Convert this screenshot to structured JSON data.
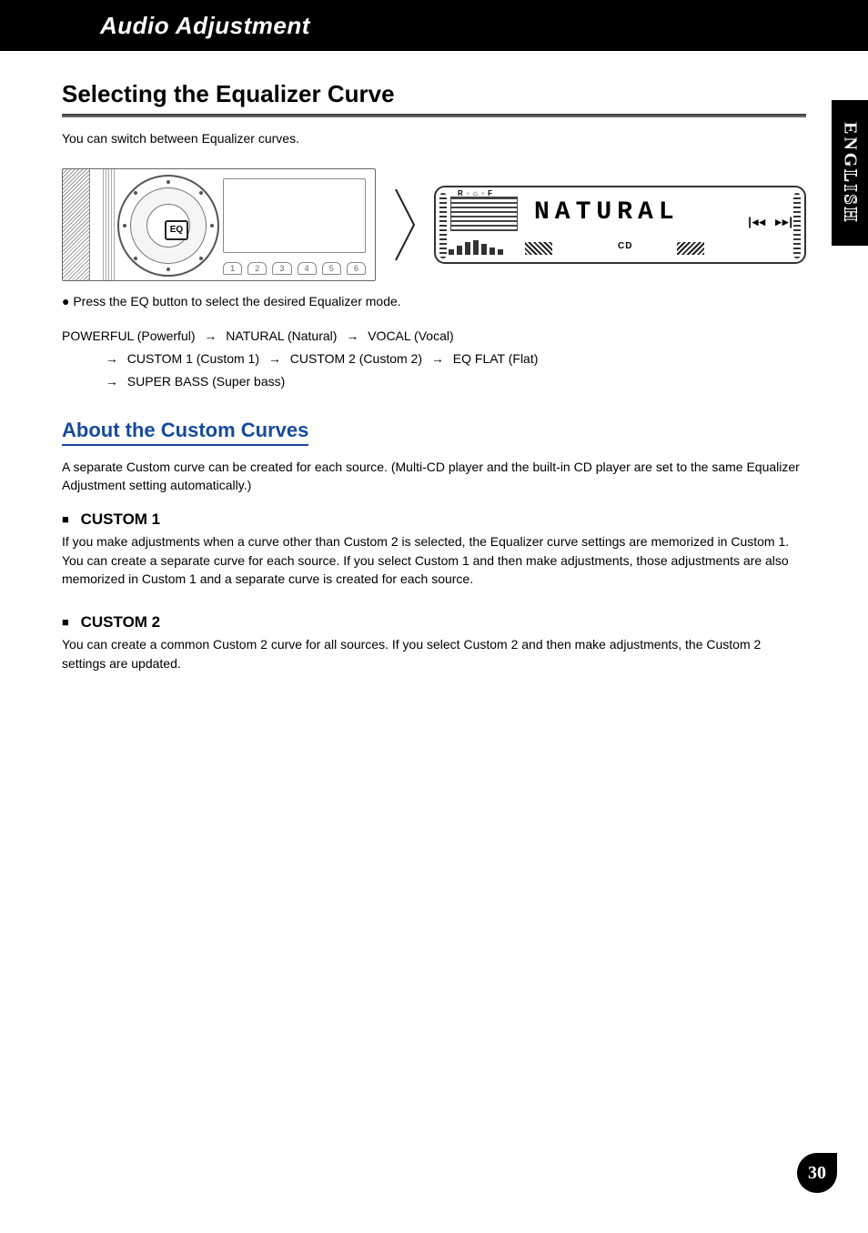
{
  "header": {
    "title": "Audio Adjustment"
  },
  "side_tab": {
    "lang_bold": "ENG",
    "lang_outline": "LISH"
  },
  "page_number": "30",
  "section": {
    "title": "Selecting the Equalizer Curve",
    "intro": "You can switch between Equalizer curves."
  },
  "panel_left": {
    "eq_button": "EQ",
    "preset_buttons": [
      "1",
      "2",
      "3",
      "4",
      "5",
      "6"
    ]
  },
  "panel_right": {
    "top_label": "R ◦ ⌂ ◦ F",
    "main_text": "NATURAL",
    "source": "CD",
    "prev": "|◂◂",
    "next": "▸▸|"
  },
  "step": {
    "label": "● Press the EQ button to select the desired Equalizer mode."
  },
  "cycle": {
    "line1": [
      "POWERFUL (Powerful)",
      "NATURAL (Natural)",
      "VOCAL (Vocal)"
    ],
    "line2_lead": "",
    "line2": [
      "CUSTOM 1 (Custom 1)",
      "CUSTOM 2 (Custom 2)",
      "EQ FLAT (Flat)"
    ],
    "line3": [
      "SUPER BASS (Super bass)"
    ]
  },
  "subsection": {
    "title": "About the Custom Curves",
    "desc": "A separate Custom curve can be created for each source. (Multi-CD player and the built-in CD player are set to the same Equalizer Adjustment setting automatically.)"
  },
  "custom1": {
    "title": "CUSTOM 1",
    "body": "If you make adjustments when a curve other than Custom 2 is selected, the Equalizer curve settings are memorized in Custom 1. You can create a separate curve for each source.\nIf you select Custom 1 and then make adjustments, those adjustments are also memorized in Custom 1 and a separate curve is created for each source."
  },
  "custom2": {
    "title": "CUSTOM 2",
    "body": "You can create a common Custom 2 curve for all sources.\nIf you select Custom 2 and then make adjustments, the Custom 2 settings are updated."
  }
}
